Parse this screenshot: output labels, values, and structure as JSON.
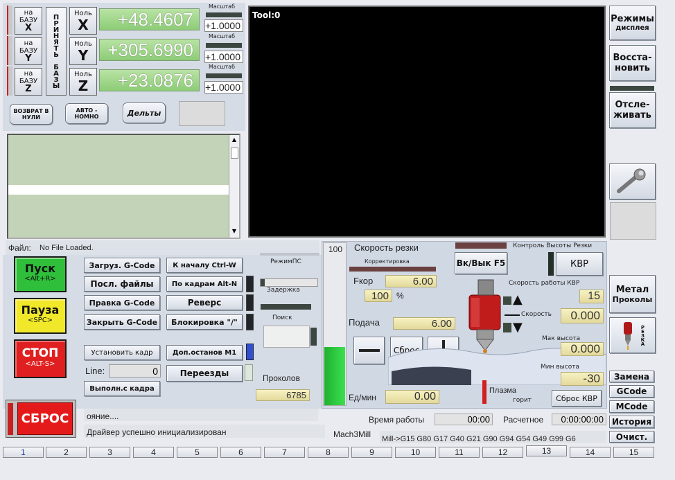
{
  "axes": [
    {
      "home_top": "на",
      "home_mid": "БАЗУ",
      "home_axis": "X",
      "zero_top": "Ноль",
      "zero_axis": "X",
      "dro": "+48.4607",
      "scale_label": "Масштаб",
      "scale": "+1.0000"
    },
    {
      "home_top": "на",
      "home_mid": "БАЗУ",
      "home_axis": "Y",
      "zero_top": "Ноль",
      "zero_axis": "Y",
      "dro": "+305.6990",
      "scale_label": "Масштаб",
      "scale": "+1.0000"
    },
    {
      "home_top": "на",
      "home_mid": "БАЗУ",
      "home_axis": "Z",
      "zero_top": "Ноль",
      "zero_axis": "Z",
      "dro": "+23.0876",
      "scale_label": "Масштаб",
      "scale": "+1.0000"
    }
  ],
  "vertical_label": "ПРИНЯТЬ БАЗЫ",
  "buttons": {
    "return_zero": "ВОЗВРАТ В НУЛИ",
    "auto": "АВТО - НОМНО",
    "deltas": "Дельты"
  },
  "viewer": {
    "tool_label": "Tool:0"
  },
  "right_buttons": {
    "display_mode_1": "Режимы",
    "display_mode_2": "дисплея",
    "restore_1": "Восста-",
    "restore_2": "новить",
    "track_1": "Отсле-",
    "track_2": "живать",
    "metal_1": "Метал",
    "metal_2": "Проколы",
    "cut_vertical": "РЕЗКА"
  },
  "file": {
    "label": "Файл:",
    "value": "No File Loaded."
  },
  "run": {
    "start": "Пуск",
    "start_key": "<Alt+R>",
    "pause": "Пауза",
    "pause_key": "<SPC>",
    "stop": "СТОП",
    "stop_key": "<ALT-S>",
    "reset": "СБРОС"
  },
  "gcode_buttons": {
    "load": "Загруз. G-Code",
    "recent": "Посл. файлы",
    "edit": "Правка G-Code",
    "close": "Закрыть G-Code",
    "to_start": "К началу Ctrl-W",
    "single": "По кадрам Alt-N",
    "reverse": "Реверс",
    "block_delete": "Блокировка \"/\"",
    "set_line": "Установить кадр",
    "opt_stop": "Доп.останов M1",
    "run_from": "Выполн.с кадра",
    "moves": "Переезды"
  },
  "line": {
    "label": "Line:",
    "value": "0"
  },
  "side_labels": {
    "mode_ps": "РежимПС",
    "delay": "Задержка",
    "search": "Поиск"
  },
  "punctures": {
    "label": "Проколов",
    "value": "6785"
  },
  "status": {
    "line1": "ояние....",
    "line2": "Драйвер успешно инициализирован",
    "profile": "Mach3Mill"
  },
  "feed": {
    "bar_max": "100",
    "cut_speed_title": "Скорость резки",
    "correction_label": "Корректировка",
    "fkor_label": "Fкор",
    "fkor_value": "6.00",
    "percent_value": "100",
    "percent_sign": "%",
    "feed_label": "Подача",
    "feed_value": "6.00",
    "reset_label": "Сброс",
    "units_label": "Ед/мин",
    "units_value": "0.00",
    "bar_level": 0.36
  },
  "thc": {
    "title": "Контроль Высоты Резки",
    "toggle": "Вк/Вык F5",
    "kvr": "КВР",
    "speed_title": "Скорость работы КВР",
    "speed_value": "15",
    "arrow_label": "Скорость",
    "rate_value": "0.000",
    "max_label": "Мак высота",
    "max_value": "0.000",
    "min_label": "Мин высота",
    "min_value": "-30",
    "plasma_label": "Плазма",
    "plasma_sub": "горит",
    "reset_kvr": "Сброс КВР"
  },
  "times": {
    "work_label": "Время работы",
    "work_value": "00:00",
    "calc_label": "Расчетное",
    "calc_value": "0:00:00:00"
  },
  "modal": "Mill->G15  G80 G17 G40 G21 G90 G94 G54 G49 G99 G6",
  "right_small": [
    "Замена",
    "GCode",
    "MCode",
    "История",
    "Очист."
  ],
  "tabs": [
    "1",
    "2",
    "3",
    "4",
    "5",
    "6",
    "7",
    "8",
    "9",
    "10",
    "11",
    "12",
    "13",
    "14",
    "15"
  ],
  "colors": {
    "start": "#2fbf3a",
    "pause": "#f0e828",
    "stop": "#e02020",
    "dro": "#8ccc76"
  }
}
